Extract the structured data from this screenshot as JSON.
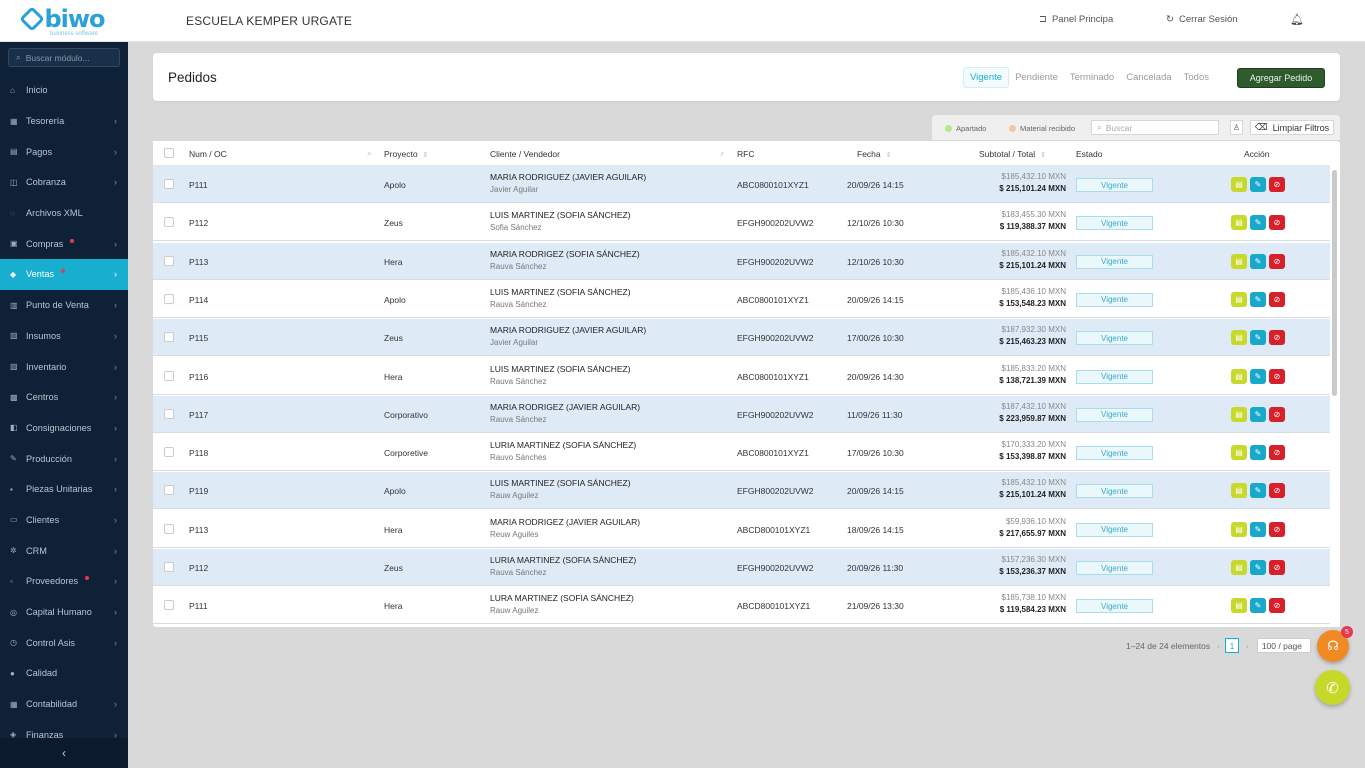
{
  "app": {
    "logo_text": "biwo",
    "logo_sub": "business software",
    "school": "ESCUELA KEMPER URGATE"
  },
  "top": {
    "panel": "Panel Principa",
    "logout": "Cerrar Sesión"
  },
  "sidebar": {
    "search_placeholder": "Buscar módulo...",
    "items": [
      {
        "label": "Inicio",
        "icon": "home-icon",
        "chevron": false,
        "dot": false
      },
      {
        "label": "Tesorería",
        "icon": "bank-icon",
        "chevron": true,
        "dot": false
      },
      {
        "label": "Pagos",
        "icon": "payment-icon",
        "chevron": true,
        "dot": false
      },
      {
        "label": "Cobranza",
        "icon": "collection-icon",
        "chevron": true,
        "dot": false
      },
      {
        "label": "Archivos XML",
        "icon": "file-icon",
        "chevron": false,
        "dot": false
      },
      {
        "label": "Compras",
        "icon": "cart-icon",
        "chevron": true,
        "dot": true
      },
      {
        "label": "Ventas",
        "icon": "tag-icon",
        "chevron": true,
        "dot": true,
        "active": true
      },
      {
        "label": "Punto de Venta",
        "icon": "pos-icon",
        "chevron": true,
        "dot": false
      },
      {
        "label": "Insumos",
        "icon": "supplies-icon",
        "chevron": true,
        "dot": false
      },
      {
        "label": "Inventario",
        "icon": "inventory-icon",
        "chevron": true,
        "dot": false
      },
      {
        "label": "Centros",
        "icon": "building-icon",
        "chevron": true,
        "dot": false
      },
      {
        "label": "Consignaciones",
        "icon": "consign-icon",
        "chevron": true,
        "dot": false
      },
      {
        "label": "Producción",
        "icon": "production-icon",
        "chevron": true,
        "dot": false
      },
      {
        "label": "Piezas Unitarias",
        "icon": "pieces-icon",
        "chevron": true,
        "dot": false
      },
      {
        "label": "Clientes",
        "icon": "clients-icon",
        "chevron": true,
        "dot": false
      },
      {
        "label": "CRM",
        "icon": "crm-icon",
        "chevron": true,
        "dot": false
      },
      {
        "label": "Proveedores",
        "icon": "suppliers-icon",
        "chevron": true,
        "dot": true
      },
      {
        "label": "Capital Humano",
        "icon": "people-icon",
        "chevron": true,
        "dot": false
      },
      {
        "label": "Control Asis",
        "icon": "clock-icon",
        "chevron": true,
        "dot": false
      },
      {
        "label": "Calidad",
        "icon": "quality-icon",
        "chevron": false,
        "dot": false
      },
      {
        "label": "Contabilidad",
        "icon": "accounting-icon",
        "chevron": true,
        "dot": false
      },
      {
        "label": "Finanzas",
        "icon": "finance-icon",
        "chevron": true,
        "dot": false
      }
    ]
  },
  "header": {
    "title": "Pedidos",
    "tabs": [
      "Vigente",
      "Pendiente",
      "Terminado",
      "Cancelada",
      "Todos"
    ],
    "add_label": "Agregar Pedido"
  },
  "filters": {
    "legend_1": "Apartado",
    "legend_2": "Material recibido",
    "legend_1_color": "#b8e986",
    "legend_2_color": "#f7c59f",
    "search_placeholder": "Buscar",
    "clear_label": "Limpiar Filtros"
  },
  "table": {
    "columns": {
      "num": "Num / OC",
      "project": "Proyecto",
      "client": "Cliente / Vendedor",
      "rfc": "RFC",
      "date": "Fecha",
      "amount": "Subtotal / Total",
      "state": "Estado",
      "action": "Acción"
    },
    "rows": [
      {
        "num": "P111",
        "project": "Apolo",
        "client": "MARIA RODRIGUEZ (JAVIER AGUILAR)",
        "seller": "Javier Aguilar",
        "rfc": "ABC0800101XYZ1",
        "date": "20/09/26 14:15",
        "subtotal": "$185,432.10 MXN",
        "total": "$ 215,101.24 MXN",
        "state": "Vigente"
      },
      {
        "num": "P112",
        "project": "Zeus",
        "client": "LUIS MARTINEZ (SOFIA SÁNCHEZ)",
        "seller": "Sofia Sánchez",
        "rfc": "EFGH900202UVW2",
        "date": "12/10/26 10:30",
        "subtotal": "$183,455.30 MXN",
        "total": "$ 119,388.37 MXN",
        "state": "Vigente"
      },
      {
        "num": "P113",
        "project": "Hera",
        "client": "MARIA RODRIGEZ (SOFIA SÁNCHEZ)",
        "seller": "Rauva Sánchez",
        "rfc": "EFGH900202UVW2",
        "date": "12/10/26 10:30",
        "subtotal": "$185,432.10 MXN",
        "total": "$ 215,101.24 MXN",
        "state": "Vigente"
      },
      {
        "num": "P114",
        "project": "Apolo",
        "client": "LUIS MARTINEZ (SOFIA SÁNCHEZ)",
        "seller": "Rauva Sánchez",
        "rfc": "ABC0800101XYZ1",
        "date": "20/09/26 14:15",
        "subtotal": "$185,436.10 MXN",
        "total": "$ 153,548.23 MXN",
        "state": "Vigente"
      },
      {
        "num": "P115",
        "project": "Zeus",
        "client": "MARIA RODRIGUEZ (JAVIER AGUILAR)",
        "seller": "Javier Aguilar",
        "rfc": "EFGH900202UVW2",
        "date": "17/00/26 10:30",
        "subtotal": "$187,932.30 MXN",
        "total": "$ 215,463.23 MXN",
        "state": "Vigente"
      },
      {
        "num": "P116",
        "project": "Hera",
        "client": "LUIS MARTINEZ (SOFIA SÁNCHEZ)",
        "seller": "Rauva Sánchez",
        "rfc": "ABC0800101XYZ1",
        "date": "20/09/26 14:30",
        "subtotal": "$185,833.20 MXN",
        "total": "$ 138,721.39 MXN",
        "state": "Vigente"
      },
      {
        "num": "P117",
        "project": "Corporativo",
        "client": "MARIA RODRIGEZ (JAVIER AGUILAR)",
        "seller": "Rauva Sánchez",
        "rfc": "EFGH900202UVW2",
        "date": "11/09/26 11:30",
        "subtotal": "$187,432.10 MXN",
        "total": "$ 223,959.87 MXN",
        "state": "Vigente"
      },
      {
        "num": "P118",
        "project": "Corporetive",
        "client": "LURIA MARTINEZ (SOFIA SÁNCHEZ)",
        "seller": "Rauvo Sánches",
        "rfc": "ABC0800101XYZ1",
        "date": "17/09/26 10:30",
        "subtotal": "$170,333.20 MXN",
        "total": "$ 153,398.87 MXN",
        "state": "Vigente"
      },
      {
        "num": "P119",
        "project": "Apolo",
        "client": "LUIS MARTINEZ (SOFIA SÁNCHEZ)",
        "seller": "Rauw Aguilez",
        "rfc": "EFGH800202UVW2",
        "date": "20/09/26 14:15",
        "subtotal": "$185,432.10 MXN",
        "total": "$ 215,101.24 MXN",
        "state": "Vigente"
      },
      {
        "num": "P113",
        "project": "Hera",
        "client": "MARIA RODRIGEZ (JAVIER AGUILAR)",
        "seller": "Reuw Aguiles",
        "rfc": "ABCD800101XYZ1",
        "date": "18/09/26 14:15",
        "subtotal": "$59,936.10 MXN",
        "total": "$ 217,655.97 MXN",
        "state": "Vigente"
      },
      {
        "num": "P112",
        "project": "Zeus",
        "client": "LURIA MARTINEZ (SOFIA SÁNCHEZ)",
        "seller": "Rauva Sánchez",
        "rfc": "EFGH900202UVW2",
        "date": "20/09/26 11:30",
        "subtotal": "$157,236.30 MXN",
        "total": "$ 153,236.37 MXN",
        "state": "Vigente"
      },
      {
        "num": "P111",
        "project": "Hera",
        "client": "LURA MARTINEZ (SOFIA SÁNCHEZ)",
        "seller": "Rauw Aguilez",
        "rfc": "ABCD800101XYZ1",
        "date": "21/09/26 13:30",
        "subtotal": "$185,738.10 MXN",
        "total": "$ 119,584.23 MXN",
        "state": "Vigente"
      }
    ]
  },
  "pager": {
    "summary": "1–24 de 24 elementos",
    "page": "1",
    "per_page": "100 / page"
  },
  "fab": {
    "badge": "5"
  }
}
